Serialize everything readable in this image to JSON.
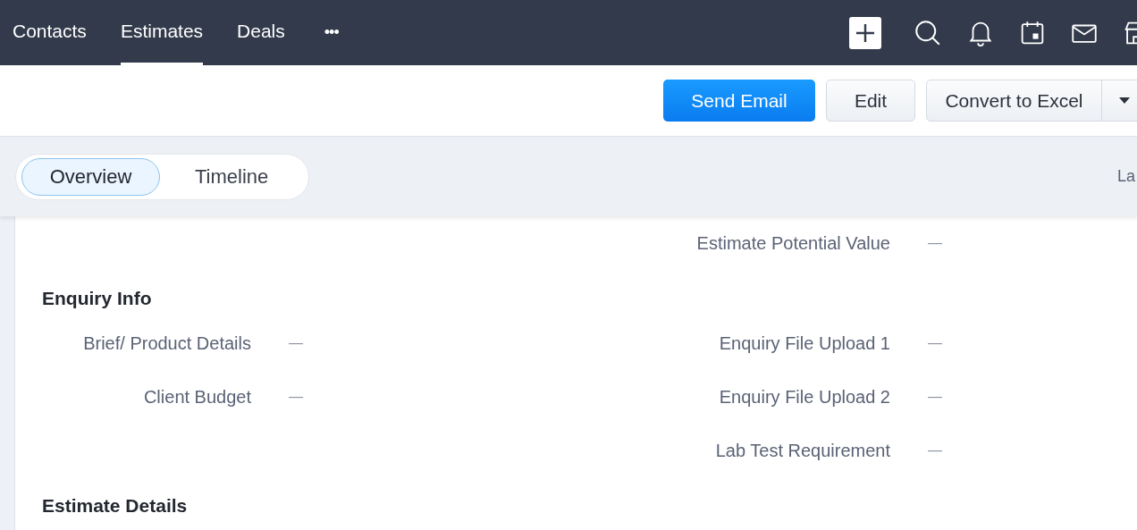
{
  "nav": {
    "tabs": [
      {
        "label": "Contacts",
        "selected": false
      },
      {
        "label": "Estimates",
        "selected": true
      },
      {
        "label": "Deals",
        "selected": false
      }
    ],
    "more": "•••"
  },
  "actions": {
    "send_email": "Send Email",
    "edit": "Edit",
    "convert": "Convert to Excel"
  },
  "view_tabs": [
    {
      "label": "Overview",
      "selected": true
    },
    {
      "label": "Timeline",
      "selected": false
    }
  ],
  "last_info": "La",
  "top_rows": [
    {
      "right": {
        "label": "Estimate Potential Value",
        "value": "—"
      }
    }
  ],
  "sections": [
    {
      "title": "Enquiry Info",
      "rows": [
        {
          "left": {
            "label": "Brief/ Product Details",
            "value": "—"
          },
          "right": {
            "label": "Enquiry File Upload 1",
            "value": "—"
          }
        },
        {
          "left": {
            "label": "Client Budget",
            "value": "—"
          },
          "right": {
            "label": "Enquiry File Upload 2",
            "value": "—"
          }
        },
        {
          "right": {
            "label": "Lab Test Requirement",
            "value": "—"
          }
        }
      ]
    },
    {
      "title": "Estimate Details"
    }
  ]
}
